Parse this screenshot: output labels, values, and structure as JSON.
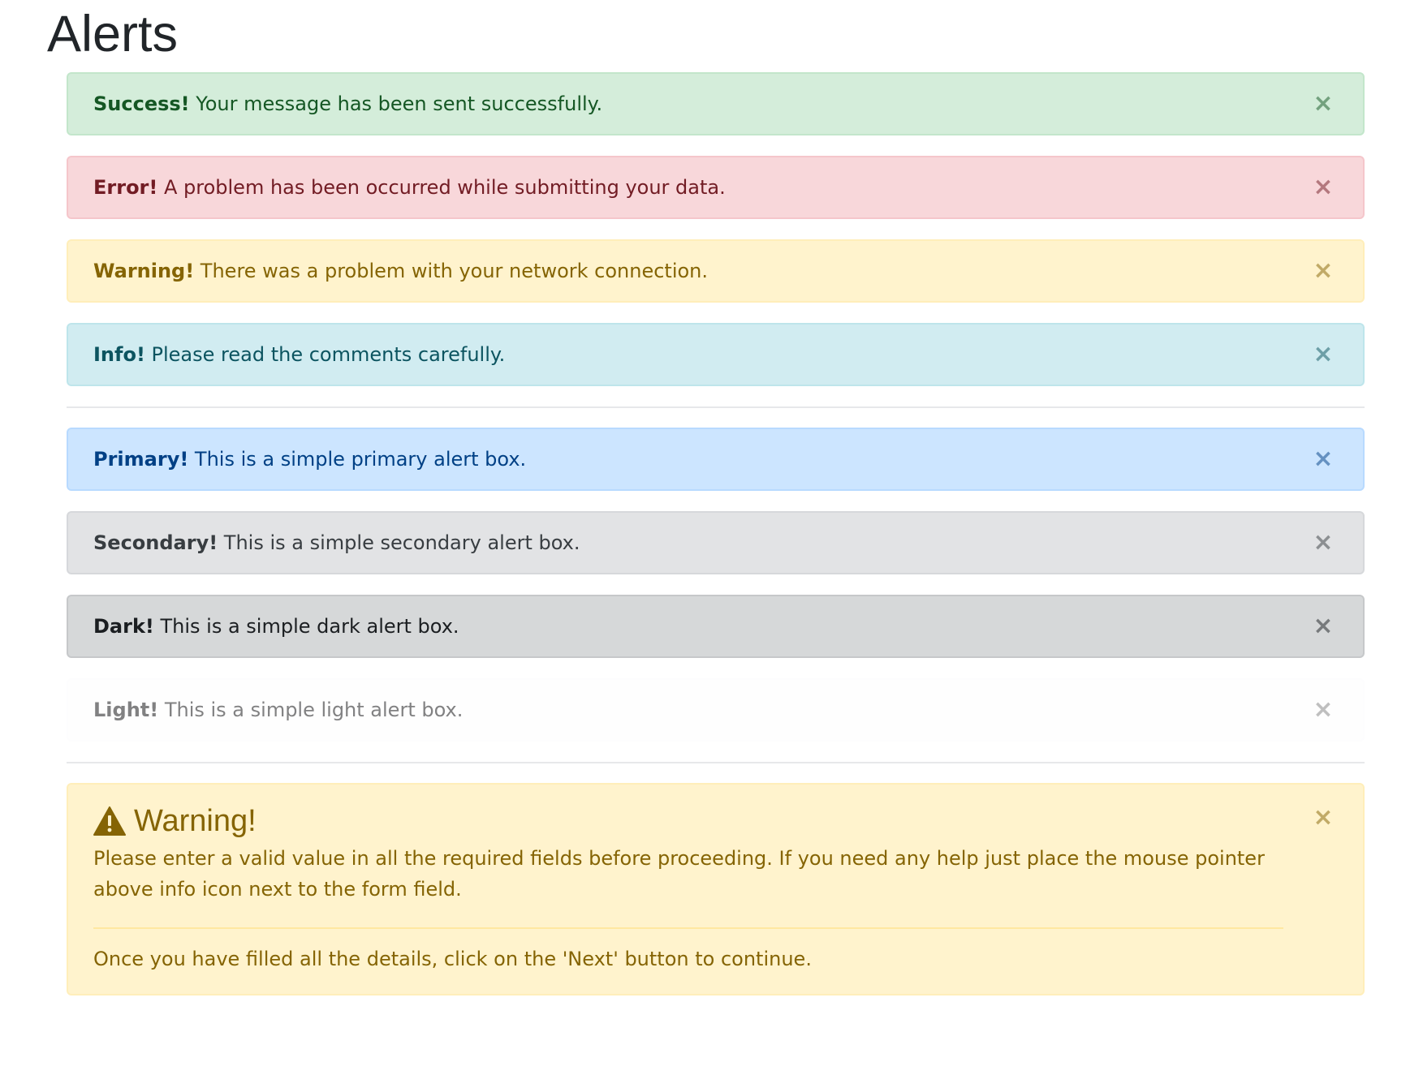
{
  "page": {
    "title": "Alerts"
  },
  "alerts": [
    {
      "strong": "Success!",
      "text": " Your message has been sent successfully.",
      "close": "×"
    },
    {
      "strong": "Error!",
      "text": " A problem has been occurred while submitting your data.",
      "close": "×"
    },
    {
      "strong": "Warning!",
      "text": " There was a problem with your network connection.",
      "close": "×"
    },
    {
      "strong": "Info!",
      "text": " Please read the comments carefully.",
      "close": "×"
    },
    {
      "strong": "Primary!",
      "text": " This is a simple primary alert box.",
      "close": "×"
    },
    {
      "strong": "Secondary!",
      "text": " This is a simple secondary alert box.",
      "close": "×"
    },
    {
      "strong": "Dark!",
      "text": " This is a simple dark alert box.",
      "close": "×"
    },
    {
      "strong": "Light!",
      "text": " This is a simple light alert box.",
      "close": "×"
    }
  ],
  "big_warning": {
    "icon": "warning-triangle-icon",
    "heading": "Warning!",
    "body": "Please enter a valid value in all the required fields before proceeding. If you need any help just place the mouse pointer above info icon next to the form field.",
    "footer": "Once you have filled all the details, click on the 'Next' button to continue.",
    "close": "×"
  },
  "colors": {
    "success_bg": "#d4edda",
    "success_text": "#155724",
    "danger_bg": "#f8d7da",
    "danger_text": "#721c24",
    "warning_bg": "#fff3cd",
    "warning_text": "#856404",
    "info_bg": "#d1ecf1",
    "info_text": "#0c5460",
    "primary_bg": "#cce5ff",
    "primary_text": "#004085",
    "secondary_bg": "#e2e3e5",
    "secondary_text": "#383d41",
    "dark_bg": "#d6d8d9",
    "dark_text": "#1b1e21",
    "light_bg": "#fefefe",
    "light_text": "#818182"
  }
}
